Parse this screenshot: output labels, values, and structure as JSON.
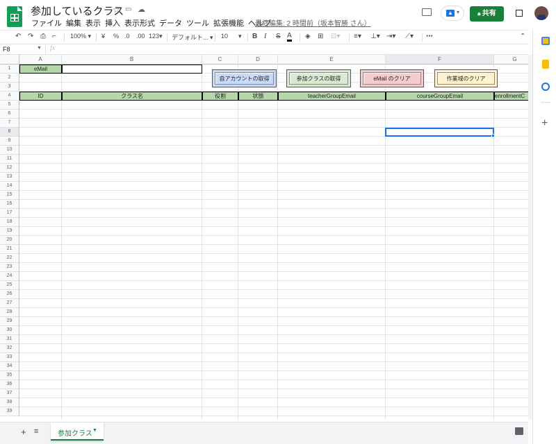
{
  "app": {
    "title": "参加しているクラス",
    "last_edit": "最終編集: 2 時間前（坂本智勝 さん）",
    "share_label": "共有",
    "menu": [
      "ファイル",
      "編集",
      "表示",
      "挿入",
      "表示形式",
      "データ",
      "ツール",
      "拡張機能",
      "ヘルプ"
    ]
  },
  "toolbar": {
    "zoom": "100%",
    "currency": "¥",
    "percent": "%",
    "decimal_dec": ".0",
    "decimal_inc": ".00",
    "number_format": "123",
    "font": "デフォルト...",
    "font_size": "10",
    "bold": "B",
    "italic": "I",
    "strike": "S",
    "text_color": "A",
    "more": "⋯"
  },
  "formula_bar": {
    "name_box": "F8",
    "fx": "fx",
    "value": ""
  },
  "grid": {
    "columns": [
      {
        "label": "A",
        "width": 61
      },
      {
        "label": "B",
        "width": 202
      },
      {
        "label": "C",
        "width": 52
      },
      {
        "label": "D",
        "width": 57
      },
      {
        "label": "E",
        "width": 155
      },
      {
        "label": "F",
        "width": 156
      },
      {
        "label": "G",
        "width": 60
      }
    ],
    "rows": [
      "1",
      "2",
      "3",
      "4",
      "5",
      "6",
      "7",
      "8",
      "9",
      "10",
      "11",
      "12",
      "13",
      "14",
      "15",
      "16",
      "17",
      "18",
      "19",
      "20",
      "21",
      "22",
      "23",
      "24",
      "25",
      "26",
      "27",
      "28",
      "29",
      "30",
      "31",
      "32",
      "33",
      "34",
      "35",
      "36",
      "37",
      "38",
      "39"
    ],
    "email_label": "eMail",
    "email_value": "",
    "headers": [
      "ID",
      "クラス名",
      "役割",
      "状態",
      "teacherGroupEmail",
      "courseGroupEmail",
      "enrollmentC"
    ],
    "selected_cell": "F8"
  },
  "buttons": {
    "get_account": {
      "label": "自アカウントの取得",
      "color": "#c9daf8"
    },
    "get_classes": {
      "label": "参加クラスの取得",
      "color": "#d9ead3"
    },
    "clear_email": {
      "label": "eMail のクリア",
      "color": "#f4cccc"
    },
    "clear_work": {
      "label": "作業域のクリア",
      "color": "#fff2cc"
    }
  },
  "sheets": [
    {
      "name": "参加クラス",
      "active": true
    }
  ],
  "colors": {
    "header_fill": "#b6d7a8",
    "accent": "#188038",
    "selection": "#1a73e8"
  },
  "icons": [
    "undo-icon",
    "redo-icon",
    "print-icon",
    "paint-format-icon",
    "star-icon",
    "folder-icon",
    "cloud-icon",
    "comment-icon",
    "present-icon",
    "lock-icon",
    "add-sheet-icon",
    "sheet-list-icon",
    "explore-icon",
    "calendar-icon",
    "keep-icon",
    "tasks-icon",
    "add-addon-icon"
  ]
}
